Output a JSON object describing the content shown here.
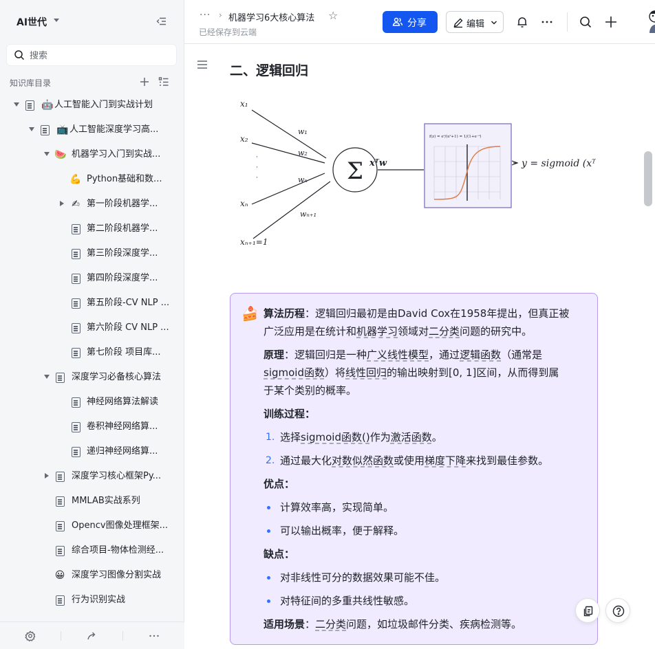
{
  "sidebar": {
    "space_title": "AI世代",
    "search_placeholder": "搜索",
    "library_label": "知识库目录",
    "tree": [
      {
        "label": "人工智能入门到实战计划",
        "icon": "robot-emoji",
        "glyph": "🤖"
      },
      {
        "label": "人工智能深度学习高...",
        "icon": "tv-emoji",
        "glyph": "📺"
      },
      {
        "label": "机器学习入门到实战...",
        "icon": "watermelon-emoji",
        "glyph": "🍉"
      },
      {
        "label": "Python基础和数...",
        "icon": "muscle-emoji",
        "glyph": "💪"
      },
      {
        "label": "第一阶段机器学...",
        "icon": "writing-hand-emoji",
        "glyph": "✍"
      },
      {
        "label": "第二阶段机器学...",
        "icon": "doc-icon"
      },
      {
        "label": "第三阶段深度学...",
        "icon": "doc-icon"
      },
      {
        "label": "第四阶段深度学...",
        "icon": "doc-icon"
      },
      {
        "label": "第五阶段-CV NLP ...",
        "icon": "doc-icon"
      },
      {
        "label": "第六阶段 CV NLP ...",
        "icon": "doc-icon"
      },
      {
        "label": "第七阶段 项目库...",
        "icon": "doc-icon"
      },
      {
        "label": "深度学习必备核心算法",
        "icon": "doc-icon"
      },
      {
        "label": "神经网络算法解读",
        "icon": "doc-icon"
      },
      {
        "label": "卷积神经网络算...",
        "icon": "doc-icon"
      },
      {
        "label": "递归神经网络算...",
        "icon": "doc-icon"
      },
      {
        "label": "深度学习核心框架Py...",
        "icon": "doc-icon"
      },
      {
        "label": "MMLAB实战系列",
        "icon": "doc-icon"
      },
      {
        "label": "Opencv图像处理框架...",
        "icon": "doc-icon"
      },
      {
        "label": "综合项目-物体检测经...",
        "icon": "doc-icon"
      },
      {
        "label": "深度学习图像分割实战",
        "icon": "grinning-emoji",
        "glyph": "😀"
      },
      {
        "label": "行为识别实战",
        "icon": "doc-icon"
      }
    ]
  },
  "topbar": {
    "more_crumb": "···",
    "crumb_separator": "›",
    "doc_title": "机器学习6大核心算法",
    "saved_status": "已经保存到云端",
    "share_label": "分享",
    "edit_label": "编辑"
  },
  "content": {
    "heading": "二、逻辑回归",
    "diagram": {
      "inputs": [
        "x₁",
        "x₂",
        "·",
        "·",
        "·",
        "xₙ",
        "xₙ₊₁=1"
      ],
      "weights": [
        "w₁",
        "w₂",
        "wₙ",
        "wₙ₊₁"
      ],
      "sum_symbol": "Σ",
      "linear_label": "xᵀw",
      "formula": "f(z) = eᶻ/(eᶻ+1) = 1/(1+e⁻ᶻ)",
      "output": "y = sigmoid (xᵀw)"
    },
    "callout": {
      "emoji": "🍰",
      "history_label": "算法历程",
      "history_text_1": "：逻辑回归最初是由David Cox在1958年提出，但真正被",
      "history_text_2a": "广泛应用是在统计和",
      "history_link_1": "机器学习",
      "history_text_2b": "领域对",
      "history_link_2": "二分类",
      "history_text_2c": "问题的研究中。",
      "principle_label": "原理",
      "principle_text_1a": "：逻辑回归是一种",
      "principle_link_1": "广义线性模型",
      "principle_text_1b": "，通过",
      "principle_link_2": "逻辑函数",
      "principle_text_1c": "（通常是",
      "principle_link_3": "sigmoid函数",
      "principle_text_2a": "）将",
      "principle_link_4": "线性回归",
      "principle_text_2b": "的输出映射到[0, 1]区间，从而得到属",
      "principle_text_3": "于某个类别的概率。",
      "training_label": "训练过程：",
      "training_steps": [
        {
          "num": "1.",
          "pre": "选择",
          "link": "sigmoid函数()",
          "post": "作为",
          "link2": "激活函数",
          "end": "。"
        },
        {
          "num": "2.",
          "pre": "通过最大化",
          "link": "对数似然函数",
          "post": "或使用",
          "link2": "梯度下降",
          "end": "来找到最佳参数。"
        }
      ],
      "pros_label": "优点：",
      "pros": [
        "计算效率高，实现简单。",
        "可以输出概率，便于解释。"
      ],
      "cons_label": "缺点：",
      "cons": [
        "对非线性可分的数据效果可能不佳。",
        "对特征间的多重共线性敏感。"
      ],
      "scenario_label": "适用场景",
      "scenario_text_a": "：",
      "scenario_link": "二分类",
      "scenario_text_b": "问题，如垃圾邮件分类、疾病检测等。"
    }
  },
  "colors": {
    "accent": "#1456f0",
    "callout_bg": "#f0ebfe",
    "callout_border": "#b799f2",
    "list_marker": "#3370ff"
  }
}
